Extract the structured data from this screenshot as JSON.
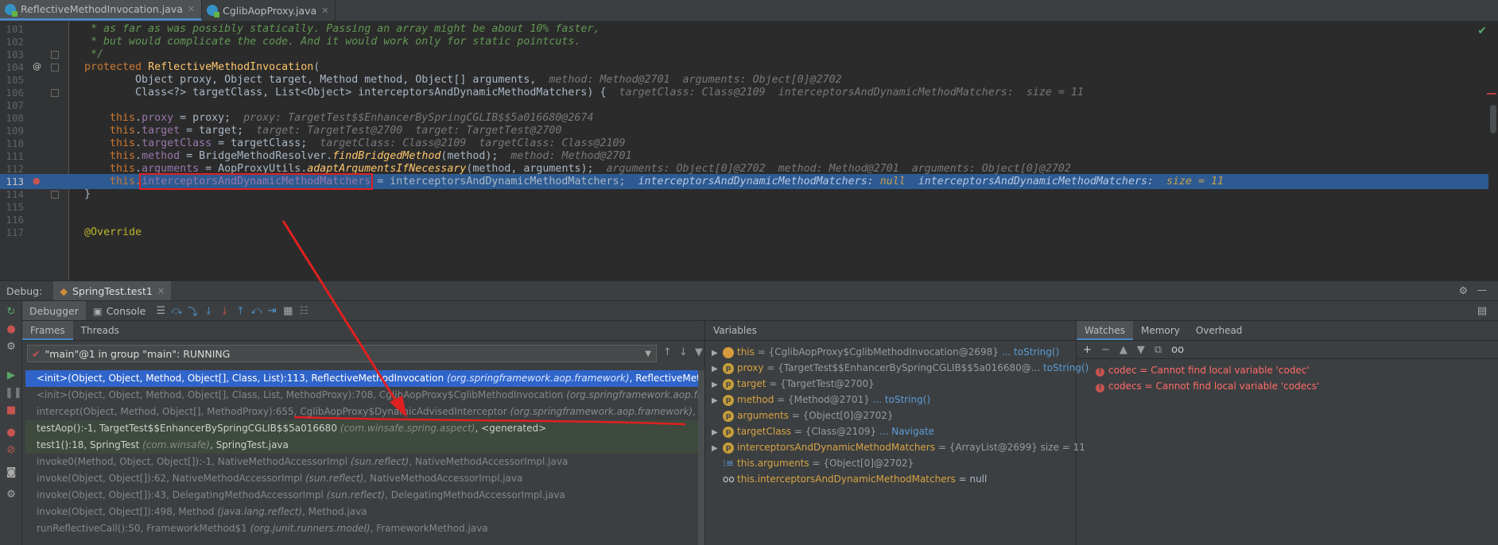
{
  "editor_tabs": [
    {
      "label": "ReflectiveMethodInvocation.java",
      "active": true
    },
    {
      "label": "CglibAopProxy.java",
      "active": false
    }
  ],
  "lines": [
    {
      "num": "101"
    },
    {
      "num": "102"
    },
    {
      "num": "103"
    },
    {
      "num": "104"
    },
    {
      "num": "105"
    },
    {
      "num": "106"
    },
    {
      "num": "107"
    },
    {
      "num": "108"
    },
    {
      "num": "109"
    },
    {
      "num": "110"
    },
    {
      "num": "111"
    },
    {
      "num": "112"
    },
    {
      "num": "113"
    },
    {
      "num": "114"
    },
    {
      "num": "115"
    },
    {
      "num": "116"
    },
    {
      "num": "117"
    }
  ],
  "code": {
    "l101": " * as far as was possibly statically. Passing an array might be about 10% faster,",
    "l102": " * but would complicate the code. And it would work only for static pointcuts.",
    "l103": " */",
    "l104_kw": "protected ",
    "l104_fn": "ReflectiveMethodInvocation",
    "l104_rest": "(",
    "l105": "        Object proxy, Object target, Method method, Object[] arguments,  ",
    "l105_hint": "method: Method@2701  arguments: Object[0]@2702",
    "l106": "        Class<?> targetClass, List<Object> interceptorsAndDynamicMethodMatchers) {  ",
    "l106_hint": "targetClass: Class@2109  interceptorsAndDynamicMethodMatchers:  size = 11",
    "l108_this": "    this",
    "l108_fld": "proxy",
    "l108_rest": " = proxy;  ",
    "l108_hint": "proxy: TargetTest$$EnhancerBySpringCGLIB$$5a016680@2674",
    "l109_this": "    this",
    "l109_fld": "target",
    "l109_rest": " = target;  ",
    "l109_hint": "target: TargetTest@2700  target: TargetTest@2700",
    "l110_this": "    this",
    "l110_fld": "targetClass",
    "l110_rest": " = targetClass;  ",
    "l110_hint": "targetClass: Class@2109  targetClass: Class@2109",
    "l111_this": "    this",
    "l111_fld": "method",
    "l111_mid": " = BridgeMethodResolver.",
    "l111_fn": "findBridgedMethod",
    "l111_rest": "(method);  ",
    "l111_hint": "method: Method@2701",
    "l112_this": "    this",
    "l112_fld": "arguments",
    "l112_mid": " = AopProxyUtils.",
    "l112_fn": "adaptArgumentsIfNecessary",
    "l112_rest": "(method, arguments);  ",
    "l112_hint": "arguments: Object[0]@2702  method: Method@2701  arguments: Object[0]@2702",
    "l113_this": "    this.",
    "l113_fld": "interceptorsAndDynamicMethodMatchers",
    "l113_rest": " = interceptorsAndDynamicMethodMatchers;  ",
    "l113_hint1": "interceptorsAndDynamicMethodMatchers: ",
    "l113_hint1v": "null",
    "l113_hint2": "  interceptorsAndDynamicMethodMatchers:  ",
    "l113_hint2v": "size = 11",
    "l114": "}",
    "l117": "@Override"
  },
  "debug": {
    "title": "Debug:",
    "session": "SpringTest.test1",
    "tabs": {
      "debugger": "Debugger",
      "console": "Console"
    },
    "frames_tab": "Frames",
    "threads_tab": "Threads",
    "thread": "\"main\"@1 in group \"main\": RUNNING",
    "frames": [
      {
        "method": "<init>(Object, Object, Method, Object[], Class, List):113, ReflectiveMethodInvocation ",
        "pkg": "(org.springframework.aop.framework)",
        "cls": ", ReflectiveMethodInv",
        "kind": "sel"
      },
      {
        "method": "<init>(Object, Object, Method, Object[], Class, List, MethodProxy):708, CglibAopProxy$CglibMethodInvocation ",
        "pkg": "(org.springframework.aop.frame",
        "cls": "",
        "kind": "lib"
      },
      {
        "method": "intercept(Object, Method, Object[], MethodProxy):655, CglibAopProxy$DynamicAdvisedInterceptor ",
        "pkg": "(org.springframework.aop.framework)",
        "cls": ", Cglib",
        "kind": "lib"
      },
      {
        "method": "testAop():-1, TargetTest$$EnhancerBySpringCGLIB$$5a016680 ",
        "pkg": "(com.winsafe.spring.aspect)",
        "cls": ", <generated>",
        "kind": "proj"
      },
      {
        "method": "test1():18, SpringTest ",
        "pkg": "(com.winsafe)",
        "cls": ", SpringTest.java",
        "kind": "proj"
      },
      {
        "method": "invoke0(Method, Object, Object[]):-1, NativeMethodAccessorImpl ",
        "pkg": "(sun.reflect)",
        "cls": ", NativeMethodAccessorImpl.java",
        "kind": "lib"
      },
      {
        "method": "invoke(Object, Object[]):62, NativeMethodAccessorImpl ",
        "pkg": "(sun.reflect)",
        "cls": ", NativeMethodAccessorImpl.java",
        "kind": "lib"
      },
      {
        "method": "invoke(Object, Object[]):43, DelegatingMethodAccessorImpl ",
        "pkg": "(sun.reflect)",
        "cls": ", DelegatingMethodAccessorImpl.java",
        "kind": "lib"
      },
      {
        "method": "invoke(Object, Object[]):498, Method ",
        "pkg": "(java.lang.reflect)",
        "cls": ", Method.java",
        "kind": "lib"
      },
      {
        "method": "runReflectiveCall():50, FrameworkMethod$1 ",
        "pkg": "(org.junit.runners.model)",
        "cls": ", FrameworkMethod.java",
        "kind": "lib"
      }
    ],
    "variables_title": "Variables",
    "variables": [
      {
        "name": "this",
        "val": " = {CglibAopProxy$CglibMethodInvocation@2698} ",
        "link": "... toString()",
        "expand": true,
        "icon": "field"
      },
      {
        "name": "proxy",
        "val": " = {TargetTest$$EnhancerBySpringCGLIB$$5a016680@...",
        "link": " toString()",
        "expand": true,
        "icon": "p"
      },
      {
        "name": "target",
        "val": " = {TargetTest@2700}",
        "link": "",
        "expand": true,
        "icon": "p"
      },
      {
        "name": "method",
        "val": " = {Method@2701} ",
        "link": "... toString()",
        "expand": true,
        "icon": "p"
      },
      {
        "name": "arguments",
        "val": " = {Object[0]@2702}",
        "link": "",
        "expand": false,
        "icon": "p"
      },
      {
        "name": "targetClass",
        "val": " = {Class@2109} ",
        "link": "... Navigate",
        "expand": true,
        "icon": "p"
      },
      {
        "name": "interceptorsAndDynamicMethodMatchers",
        "val": " = {ArrayList@2699}  size = 11",
        "link": "",
        "expand": true,
        "icon": "p"
      },
      {
        "name": "this.arguments",
        "val": " = {Object[0]@2702}",
        "link": "",
        "expand": false,
        "icon": "arr"
      },
      {
        "name": "this.interceptorsAndDynamicMethodMatchers",
        "val": " = null",
        "link": "",
        "expand": false,
        "icon": "watch"
      }
    ],
    "watch_tabs": [
      "Watches",
      "Memory",
      "Overhead"
    ],
    "watches": [
      {
        "name": "codec",
        "msg": " = Cannot find local variable 'codec'"
      },
      {
        "name": "codecs",
        "msg": " = Cannot find local variable 'codecs'"
      }
    ]
  },
  "colors": {
    "selection": "#2d5a91",
    "frame_selected": "#2f65ca",
    "annotation": "#e02020"
  }
}
